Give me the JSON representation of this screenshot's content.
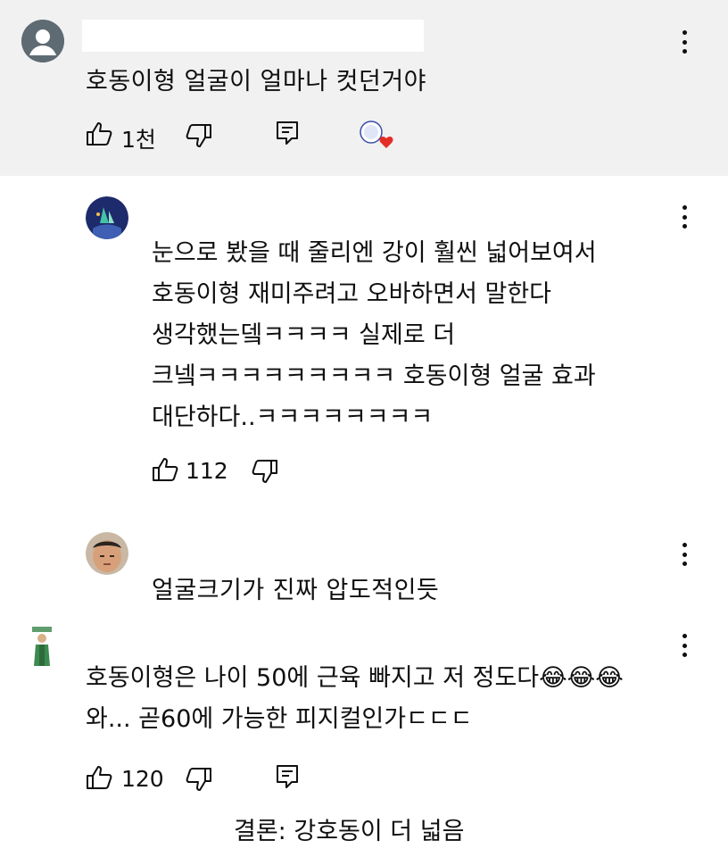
{
  "comments": [
    {
      "text": "호동이형 얼굴이 얼마나 컷던거야",
      "likes": "1천",
      "has_reply_button": true,
      "hearted": true,
      "heart_color": "#e52d27"
    },
    {
      "text_lines": [
        "눈으로 봤을 때 줄리엔 강이 훨씬 넓어보여서",
        "호동이형 재미주려고 오바하면서 말한다",
        "생각했는뎈ㅋㅋㅋㅋ 실제로 더",
        "크넼ㅋㅋㅋㅋㅋㅋㅋㅋㅋ 호동이형 얼굴 효과",
        "대단하다..ㅋㅋㅋㅋㅋㅋㅋㅋ"
      ],
      "likes": "112"
    },
    {
      "text": "얼굴크기가 진짜 압도적인듯"
    },
    {
      "text_lines": [
        "호동이형은 나이 50에 근육 빠지고 저 정도다😂😂😂",
        "와... 곧60에 가능한 피지컬인가ㄷㄷㄷ"
      ],
      "likes": "120",
      "has_reply_button": true
    }
  ],
  "caption": "결론: 강호동이 더 넓음",
  "colors": {
    "top_background": "#f1f1f1",
    "text": "#0f0f0f",
    "heart": "#e52d27"
  },
  "icons": [
    "thumb-up-icon",
    "thumb-down-icon",
    "reply-icon",
    "more-vert-icon",
    "heart-icon"
  ]
}
